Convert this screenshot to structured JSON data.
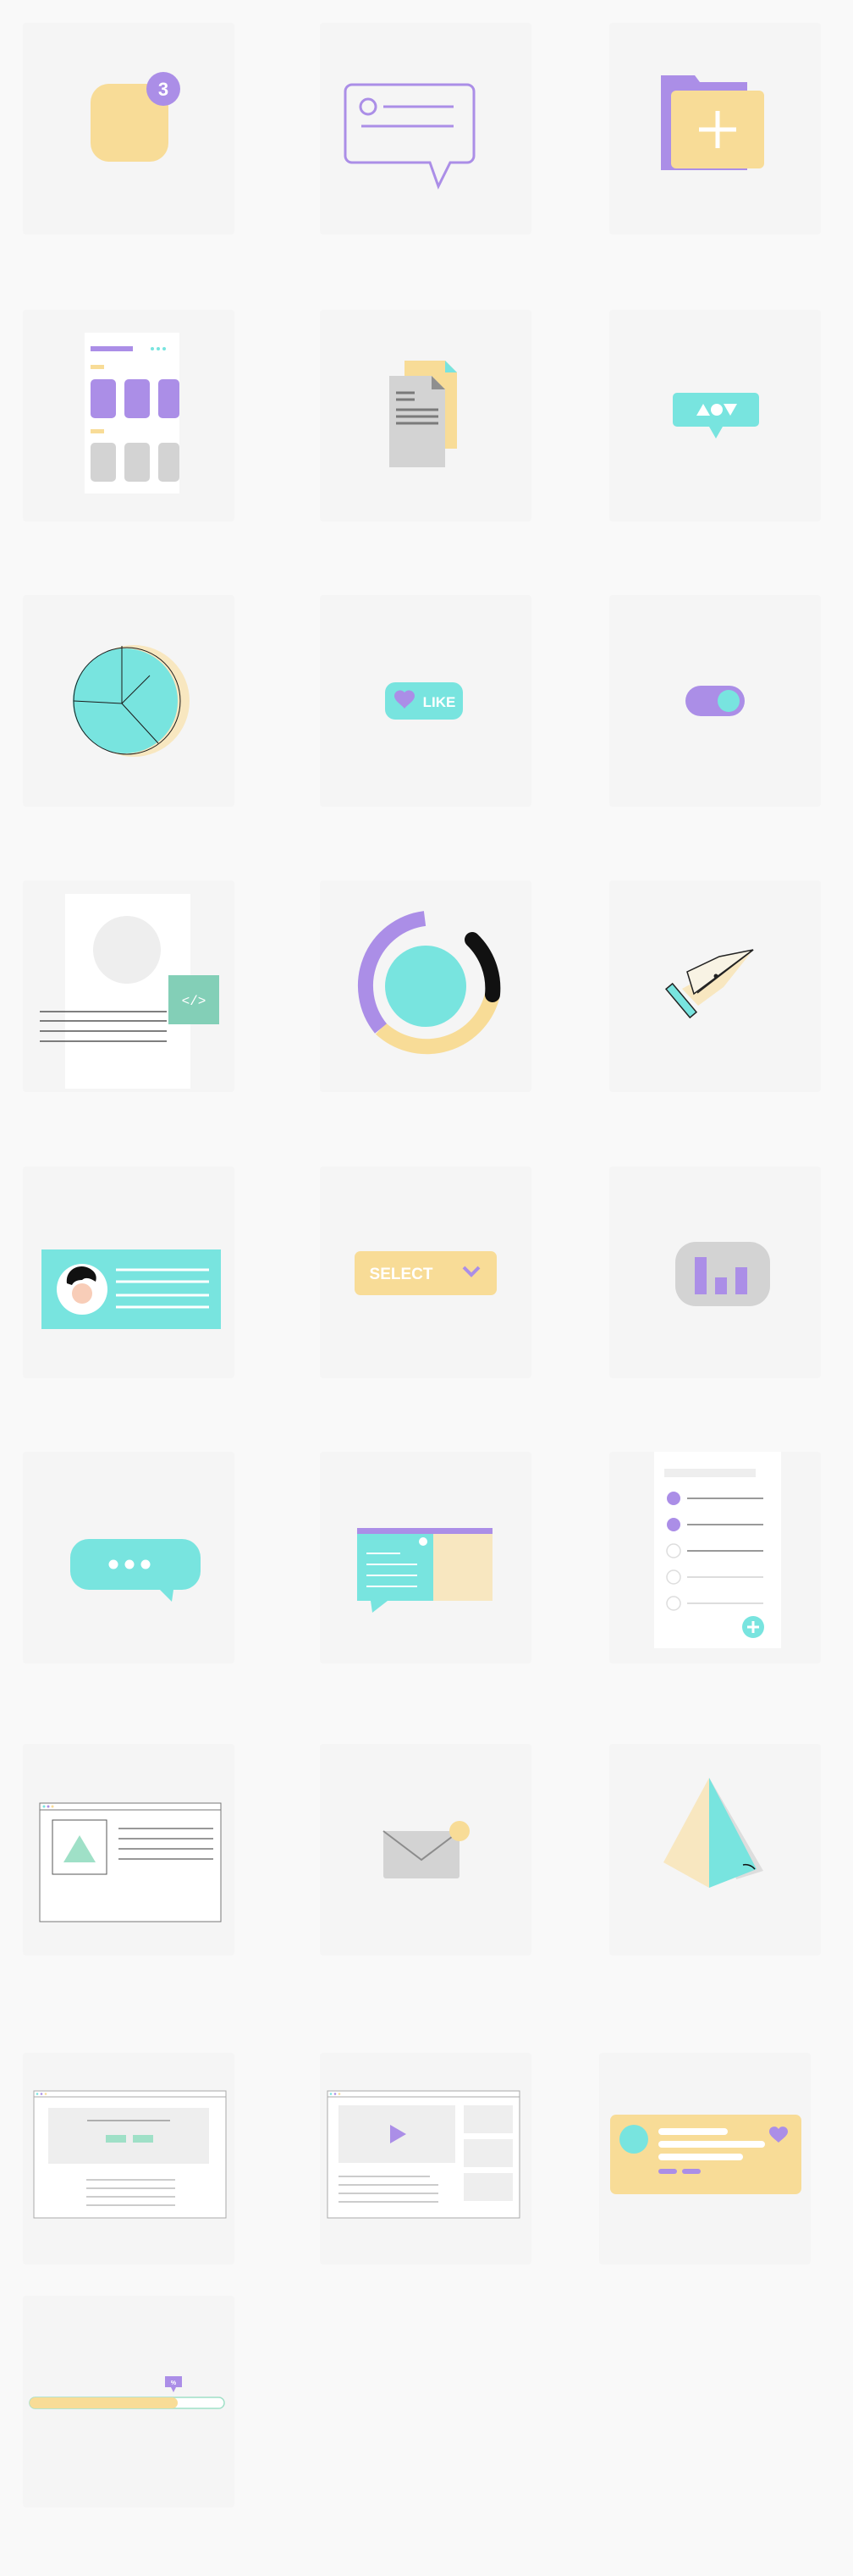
{
  "colors": {
    "purple": "#ab8ee7",
    "yellow": "#f8dc97",
    "teal": "#78e4df",
    "gray": "#d3d3d3",
    "tile_bg": "#f5f5f5",
    "page_bg": "#f9f9f9"
  },
  "notification": {
    "count": "3"
  },
  "like_button": {
    "label": "LIKE"
  },
  "select_dropdown": {
    "label": "SELECT"
  },
  "icons": [
    "notification-badge-icon",
    "chat-message-icon",
    "add-folder-icon",
    "mobile-app-layout-icon",
    "documents-icon",
    "shapes-speech-bubble-icon",
    "pie-chart-icon",
    "like-button-icon",
    "toggle-switch-icon",
    "code-profile-card-icon",
    "donut-progress-icon",
    "pen-tool-icon",
    "user-profile-card-icon",
    "select-dropdown-icon",
    "bar-chart-icon",
    "typing-bubble-icon",
    "chat-window-icon",
    "checklist-icon",
    "image-layout-window-icon",
    "mail-notification-icon",
    "pyramid-icon",
    "landing-page-window-icon",
    "video-page-window-icon",
    "social-post-card-icon",
    "progress-bar-icon"
  ]
}
